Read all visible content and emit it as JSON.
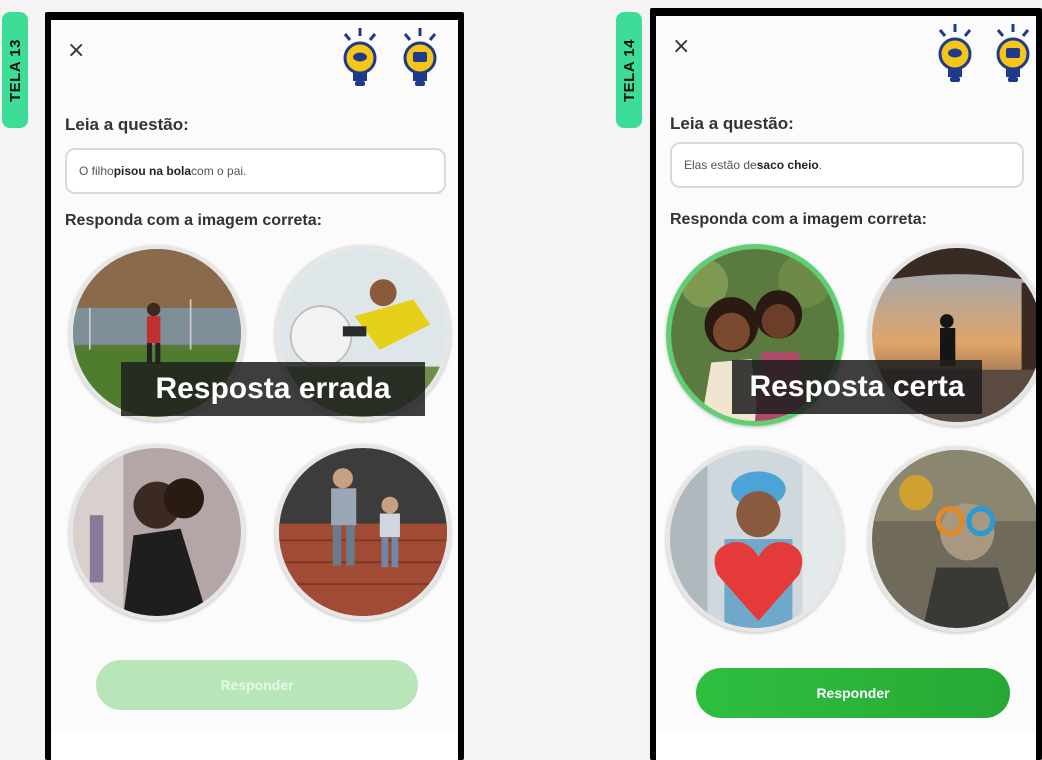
{
  "screens": [
    {
      "tag": "TELA 13",
      "close_label": "×",
      "question_label": "Leia a questão:",
      "sentence": {
        "before": "O filho ",
        "bold": "pisou na bola",
        "after": " com o pai."
      },
      "answer_label": "Responda com a imagem correta:",
      "feedback": "Resposta errada",
      "respond_label": "Responder",
      "respond_state": "disabled"
    },
    {
      "tag": "TELA 14",
      "close_label": "×",
      "question_label": "Leia a questão:",
      "sentence": {
        "before": "Elas estão de ",
        "bold": "saco cheio",
        "after": "."
      },
      "answer_label": "Responda com a imagem correta:",
      "feedback": "Resposta certa",
      "respond_label": "Responder",
      "respond_state": "active"
    }
  ],
  "colors": {
    "tag": "#3ddc97",
    "correct_border": "#5fcf74",
    "button_active": "#2fbf3f",
    "button_disabled": "#b8e6b8"
  }
}
